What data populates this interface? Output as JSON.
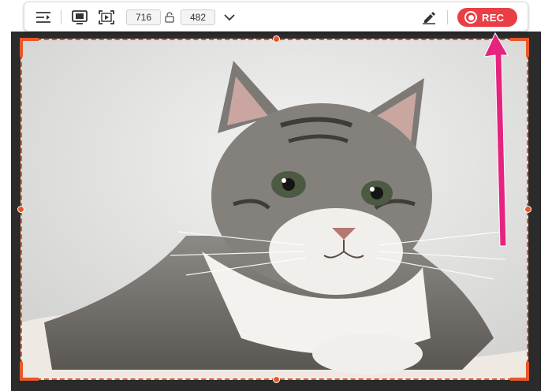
{
  "toolbar": {
    "icons": [
      "collapse-icon",
      "full-screen-icon",
      "custom-region-icon",
      "aspect-lock-icon",
      "chevron-down-icon",
      "pen-icon"
    ],
    "width_value": "716",
    "height_value": "482",
    "rec_label": "REC"
  },
  "capture": {
    "subject": "cat-photo"
  },
  "colors": {
    "frame": "#e8572a",
    "rec": "#ea3e47",
    "arrow": "#e6237e"
  }
}
